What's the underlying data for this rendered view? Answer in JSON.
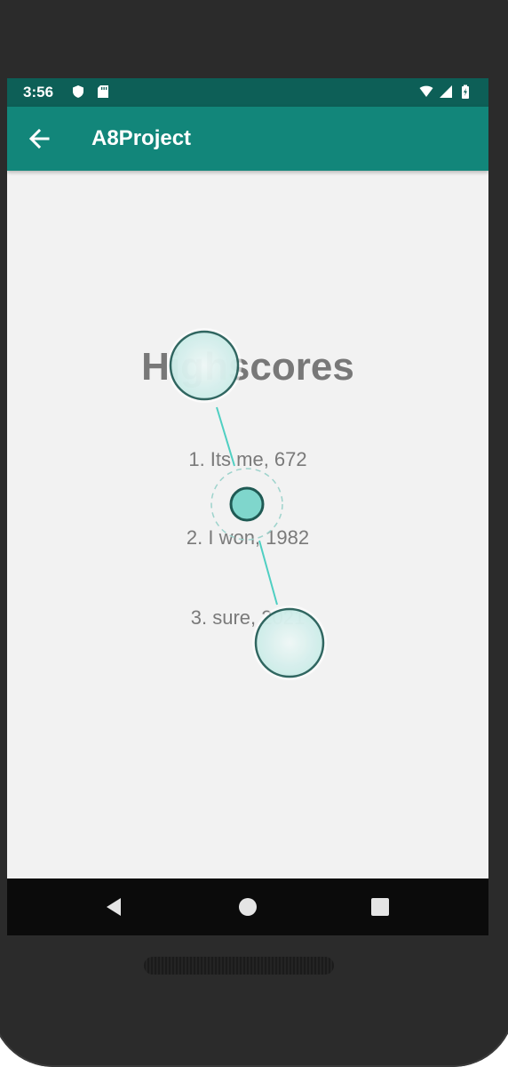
{
  "status_bar": {
    "time": "3:56",
    "icons": [
      "shield-icon",
      "sd-card-icon",
      "wifi-icon",
      "cell-signal-icon",
      "battery-charging-icon"
    ]
  },
  "app_bar": {
    "title": "A8Project",
    "back_icon": "arrow-back-icon"
  },
  "main": {
    "heading": "Highscores",
    "scores": [
      {
        "label": "1. Its me, 672"
      },
      {
        "label": "2. I won, 1982"
      },
      {
        "label": "3. sure, 2021"
      }
    ]
  },
  "nav_bar": {
    "buttons": [
      "back-triangle-icon",
      "home-circle-icon",
      "recents-square-icon"
    ]
  },
  "colors": {
    "status_bar": "#0d5f57",
    "app_bar": "#12867a",
    "background": "#f2f2f2",
    "touch_overlay": "#7fd6cc"
  }
}
